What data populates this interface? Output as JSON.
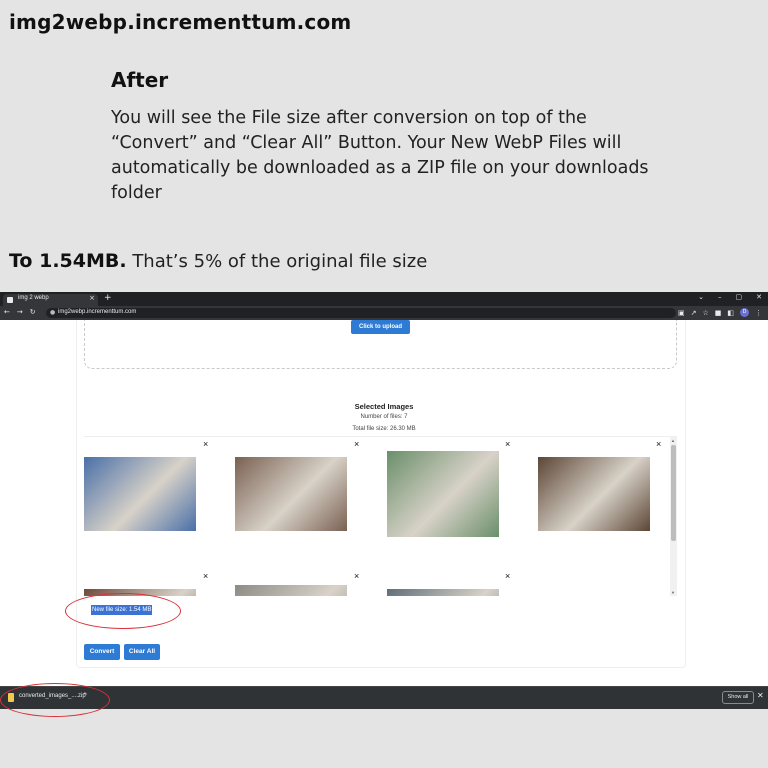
{
  "site_title": "img2webp.incrementtum.com",
  "section": {
    "heading": "After",
    "body": "You will see the File size after conversion on top of the “Convert” and “Clear All” Button. Your New WebP Files will automatically be downloaded as a ZIP file on your downloads folder"
  },
  "result": {
    "strong": "To 1.54MB.",
    "rest": " That’s 5% of the original file size"
  },
  "browser": {
    "tab_title": "img 2 webp",
    "tab_close": "×",
    "new_tab": "+",
    "url": "img2webp.incrementtum.com",
    "avatar_letter": "D",
    "window_controls": [
      "⌄",
      "–",
      "▢",
      "✕"
    ]
  },
  "app": {
    "upload_label": "Click to upload",
    "selected_title": "Selected Images",
    "file_count": "Number of files: 7",
    "file_total": "Total file size: 26.30 MB",
    "remove_glyph": "×",
    "new_file_size": "New file size: 1.54 MB",
    "convert_label": "Convert",
    "clear_label": "Clear All",
    "thumb_colors": [
      "#4a6fa8",
      "#7a6152",
      "#6a8f6a",
      "#5c4636",
      "#6e4a3c",
      "#8b8b85",
      "#5e6e78"
    ]
  },
  "download": {
    "filename": "converted_images_....zip",
    "caret": "^",
    "show_all": "Show all",
    "close": "✕"
  },
  "colors": {
    "accent": "#2e7bd6",
    "highlight": "#3a73d4",
    "annotation": "#d9303a"
  }
}
